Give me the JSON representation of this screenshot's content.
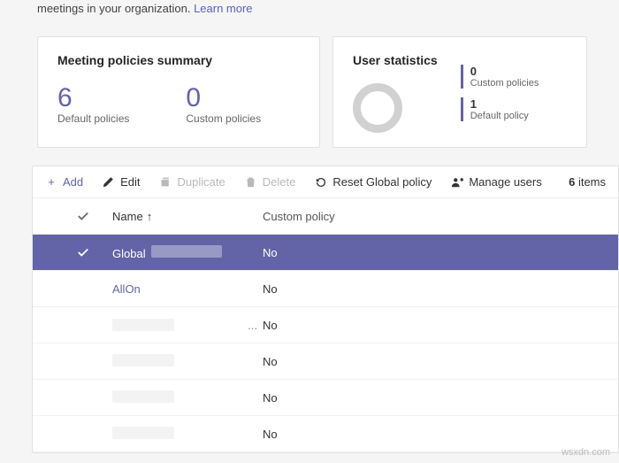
{
  "intro": {
    "text": "meetings in your organization.",
    "link": "Learn more"
  },
  "summary": {
    "title": "Meeting policies summary",
    "default_count": "6",
    "default_label": "Default policies",
    "custom_count": "0",
    "custom_label": "Custom policies"
  },
  "stats": {
    "title": "User statistics",
    "custom_val": "0",
    "custom_label": "Custom policies",
    "default_val": "1",
    "default_label": "Default policy"
  },
  "toolbar": {
    "add": "Add",
    "edit": "Edit",
    "duplicate": "Duplicate",
    "delete": "Delete",
    "reset": "Reset Global policy",
    "manage": "Manage users",
    "count_num": "6",
    "count_word": "items"
  },
  "columns": {
    "name": "Name",
    "custom": "Custom policy"
  },
  "rows": [
    {
      "name": "Global",
      "custom": "No",
      "selected": true,
      "redact_after": true,
      "link": false
    },
    {
      "name": "AllOn",
      "custom": "No",
      "selected": false,
      "link": true
    },
    {
      "name": "",
      "custom": "No",
      "selected": false,
      "redacted": true,
      "ellipsis": true
    },
    {
      "name": "",
      "custom": "No",
      "selected": false,
      "redacted": true
    },
    {
      "name": "",
      "custom": "No",
      "selected": false,
      "redacted": true
    },
    {
      "name": "",
      "custom": "No",
      "selected": false,
      "redacted": true
    }
  ],
  "watermark": "wsxdn.com"
}
